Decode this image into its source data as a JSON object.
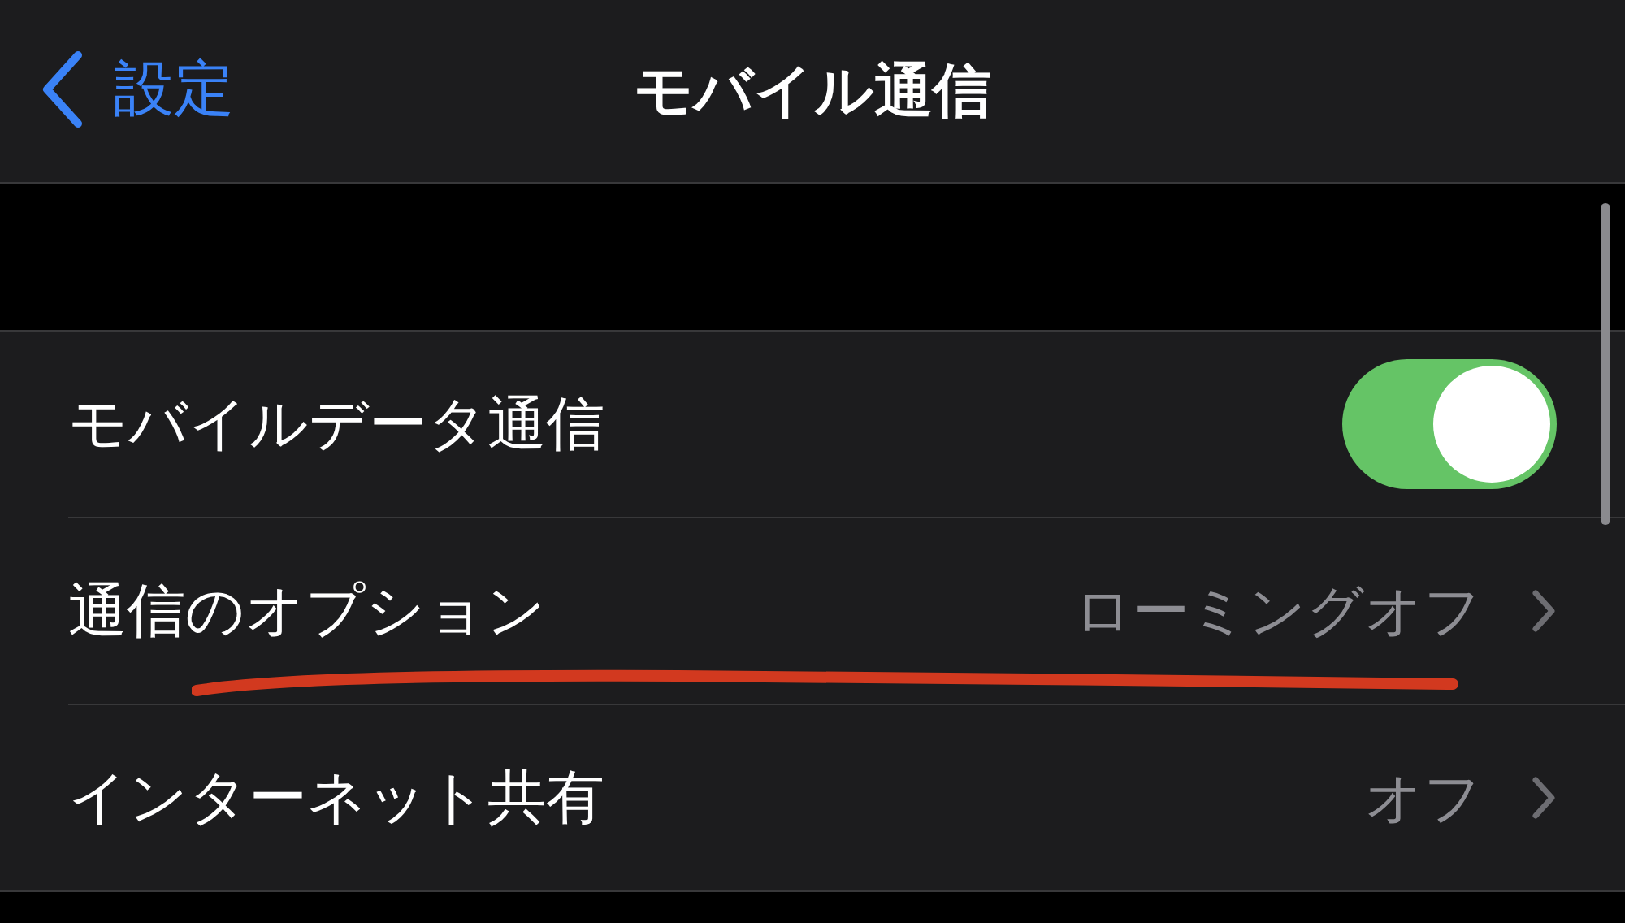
{
  "nav": {
    "back_label": "設定",
    "title": "モバイル通信"
  },
  "rows": [
    {
      "kind": "toggle",
      "label": "モバイルデータ通信",
      "on": true,
      "underlined": false
    },
    {
      "kind": "link",
      "label": "通信のオプション",
      "value": "ローミングオフ",
      "underlined": true
    },
    {
      "kind": "link",
      "label": "インターネット共有",
      "value": "オフ",
      "underlined": false
    }
  ]
}
